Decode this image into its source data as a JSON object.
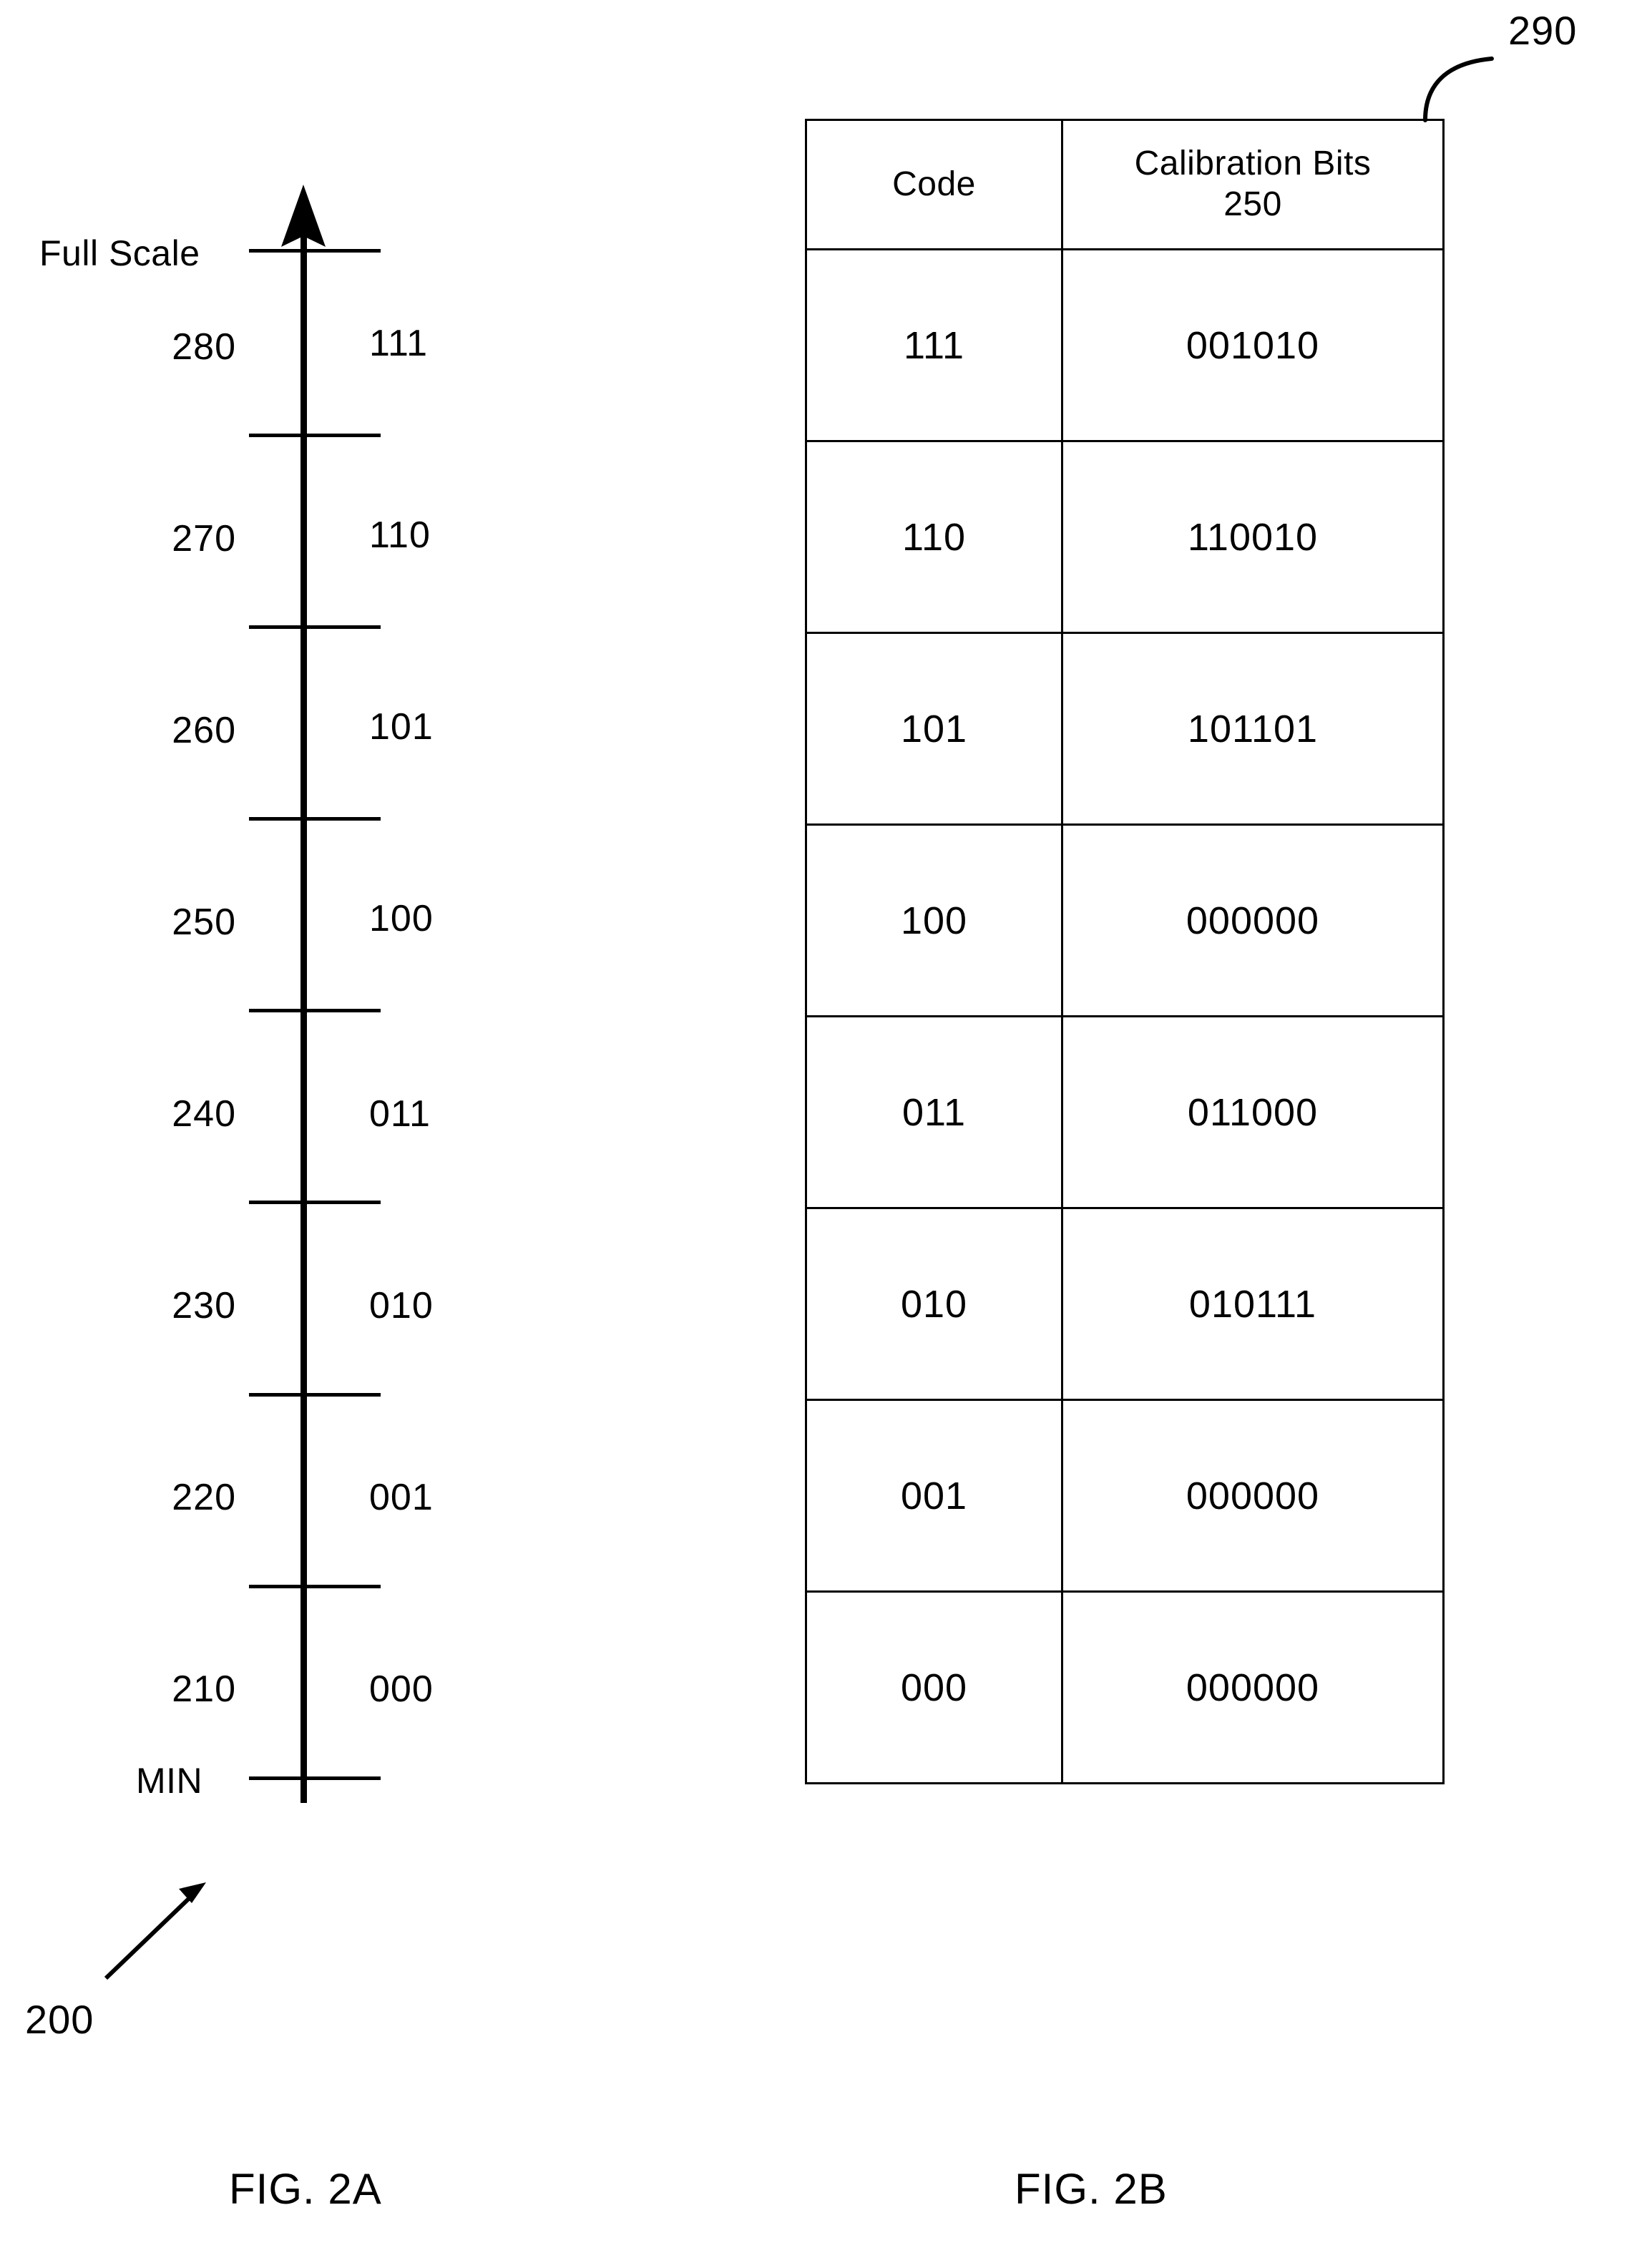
{
  "figure_a": {
    "caption": "FIG. 2A",
    "reference_numeral": "200",
    "top_label": "Full Scale",
    "bottom_label": "MIN",
    "segments": [
      {
        "ref": "280",
        "code": "111"
      },
      {
        "ref": "270",
        "code": "110"
      },
      {
        "ref": "260",
        "code": "101"
      },
      {
        "ref": "250",
        "code": "100"
      },
      {
        "ref": "240",
        "code": "011"
      },
      {
        "ref": "230",
        "code": "010"
      },
      {
        "ref": "220",
        "code": "001"
      },
      {
        "ref": "210",
        "code": "000"
      }
    ]
  },
  "figure_b": {
    "caption": "FIG. 2B",
    "reference_numeral": "290",
    "table": {
      "headers": {
        "code": "Code",
        "bits_line1": "Calibration Bits",
        "bits_line2": "250"
      },
      "rows": [
        {
          "code": "111",
          "bits": "001010"
        },
        {
          "code": "110",
          "bits": "110010"
        },
        {
          "code": "101",
          "bits": "101101"
        },
        {
          "code": "100",
          "bits": "000000"
        },
        {
          "code": "011",
          "bits": "011000"
        },
        {
          "code": "010",
          "bits": "010111"
        },
        {
          "code": "001",
          "bits": "000000"
        },
        {
          "code": "000",
          "bits": "000000"
        }
      ]
    }
  },
  "colors": {
    "ink": "#000000",
    "paper": "#ffffff"
  }
}
